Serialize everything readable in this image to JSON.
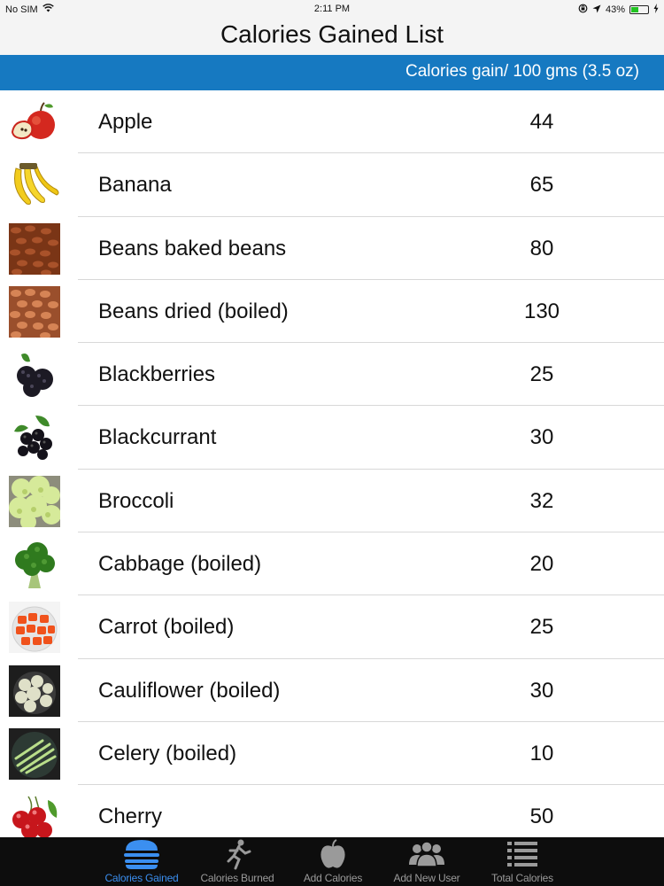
{
  "status_bar": {
    "carrier": "No SIM",
    "time": "2:11 PM",
    "battery": "43%",
    "battery_level": 0.43,
    "icons": [
      "wifi-icon",
      "lock-rotation-icon",
      "location-arrow-icon",
      "battery-icon",
      "charging-bolt-icon"
    ]
  },
  "nav": {
    "title": "Calories Gained List"
  },
  "header": {
    "column_label": "Calories gain/ 100 gms (3.5 oz)"
  },
  "colors": {
    "header_blue": "#1679c1",
    "tab_bar": "#0d0d0d",
    "tab_active": "#3b8ff0",
    "tab_inactive": "#9a9a9a"
  },
  "foods": [
    {
      "name": "Apple",
      "calories": "44",
      "icon": "apple-image"
    },
    {
      "name": "Banana",
      "calories": "65",
      "icon": "banana-image"
    },
    {
      "name": "Beans baked beans",
      "calories": "80",
      "icon": "baked-beans-image"
    },
    {
      "name": "Beans dried (boiled)",
      "calories": "130",
      "icon": "dried-beans-image"
    },
    {
      "name": "Blackberries",
      "calories": "25",
      "icon": "blackberries-image"
    },
    {
      "name": "Blackcurrant",
      "calories": "30",
      "icon": "blackcurrant-image"
    },
    {
      "name": "Broccoli",
      "calories": "32",
      "icon": "broccoli-image"
    },
    {
      "name": "Cabbage (boiled)",
      "calories": "20",
      "icon": "cabbage-image"
    },
    {
      "name": "Carrot (boiled)",
      "calories": "25",
      "icon": "carrot-image"
    },
    {
      "name": "Cauliflower (boiled)",
      "calories": "30",
      "icon": "cauliflower-image"
    },
    {
      "name": "Celery (boiled)",
      "calories": "10",
      "icon": "celery-image"
    },
    {
      "name": "Cherry",
      "calories": "50",
      "icon": "cherry-image"
    }
  ],
  "tabs": [
    {
      "label": "Calories Gained",
      "icon": "burger-icon",
      "active": true
    },
    {
      "label": "Calories Burned",
      "icon": "runner-icon",
      "active": false
    },
    {
      "label": "Add Calories",
      "icon": "apple-icon",
      "active": false
    },
    {
      "label": "Add New User",
      "icon": "users-icon",
      "active": false
    },
    {
      "label": "Total Calories",
      "icon": "list-icon",
      "active": false
    }
  ]
}
